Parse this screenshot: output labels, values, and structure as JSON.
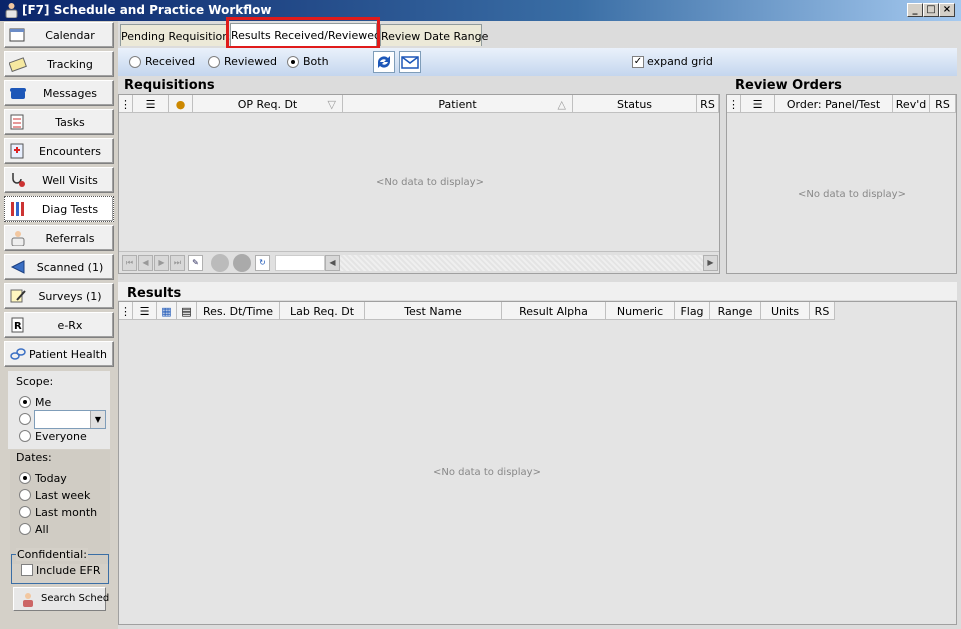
{
  "window": {
    "title": "[F7] Schedule and Practice Workflow"
  },
  "nav": {
    "items": [
      {
        "label": "Calendar"
      },
      {
        "label": "Tracking"
      },
      {
        "label": "Messages"
      },
      {
        "label": "Tasks"
      },
      {
        "label": "Encounters"
      },
      {
        "label": "Well Visits"
      },
      {
        "label": "Diag Tests"
      },
      {
        "label": "Referrals"
      },
      {
        "label": "Scanned (1)"
      },
      {
        "label": "Surveys (1)"
      },
      {
        "label": "e-Rx"
      },
      {
        "label": "Patient Health ..."
      }
    ],
    "scope_label": "Scope:",
    "scope_me": "Me",
    "scope_everyone": "Everyone",
    "dates_label": "Dates:",
    "dates_today": "Today",
    "dates_last_week": "Last week",
    "dates_last_month": "Last month",
    "dates_all": "All",
    "confidential_label": "Confidential:",
    "include_efr": "Include EFR",
    "search_sched": "Search Sched"
  },
  "tabs": [
    {
      "label": "Pending Requisitions"
    },
    {
      "label": "Results Received/Reviewed"
    },
    {
      "label": "Review Date Range"
    }
  ],
  "toolbar": {
    "received": "Received",
    "reviewed": "Reviewed",
    "both": "Both",
    "expand_grid": "expand grid"
  },
  "requisitions": {
    "title": "Requisitions",
    "columns": [
      "OP Req. Dt",
      "Patient",
      "Status",
      "RS"
    ],
    "empty": "<No data to display>"
  },
  "review_orders": {
    "title": "Review Orders",
    "columns": [
      "Order:  Panel/Test",
      "Rev'd",
      "RS"
    ],
    "empty": "<No data to display>"
  },
  "results": {
    "title": "Results",
    "columns": [
      "Res. Dt/Time",
      "Lab Req. Dt",
      "Test Name",
      "Result Alpha",
      "Numeric",
      "Flag",
      "Range",
      "Units",
      "RS"
    ],
    "empty": "<No data to display>"
  },
  "colors": {
    "highlight": "#e01b1b",
    "titlebar": "#0a246a"
  }
}
